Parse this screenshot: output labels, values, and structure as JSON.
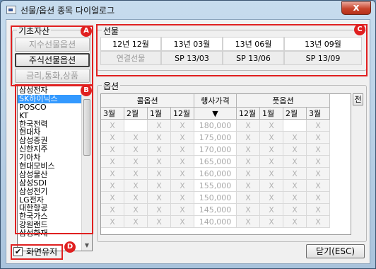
{
  "window": {
    "title": "선물/옵션 종목 다이얼로그",
    "close_glyph": "x"
  },
  "underlying": {
    "title": "기초자산",
    "buttons": [
      {
        "label": "지수선물옵션",
        "state": "disabled"
      },
      {
        "label": "주식선물옵션",
        "state": "active"
      },
      {
        "label": "금리,통화,상품",
        "state": "disabled"
      }
    ]
  },
  "stock_list": {
    "items": [
      "삼성전자",
      "SK하이닉스",
      "POSCO",
      "KT",
      "한국전력",
      "현대차",
      "삼성증권",
      "신한지주",
      "기아차",
      "현대모비스",
      "삼성물산",
      "삼성SDI",
      "삼성전기",
      "LG전자",
      "대한항공",
      "한국가스",
      "강원랜드",
      "삼성화재"
    ],
    "selected_index": 1
  },
  "futures": {
    "title": "선물",
    "months": [
      "12년 12월",
      "13년 03월",
      "13년 06월",
      "13년 09월"
    ],
    "rows2": [
      "연결선물",
      "SP 13/03",
      "SP 13/06",
      "SP 13/09"
    ]
  },
  "options": {
    "title": "옵션",
    "call_label": "콜옵션",
    "strike_label": "행사가격",
    "put_label": "풋옵션",
    "corner_label": "전",
    "sort_glyph": "▼",
    "call_months": [
      "3월",
      "2월",
      "1월",
      "12월"
    ],
    "put_months": [
      "12월",
      "1월",
      "2월",
      "3월"
    ],
    "strikes": [
      "180,000",
      "175,000",
      "170,000",
      "165,000",
      "160,000",
      "155,000",
      "150,000",
      "145,000",
      "140,000"
    ],
    "mark": "X"
  },
  "footer": {
    "keep_screen_label": "화면유지",
    "keep_screen_checked": true,
    "check_glyph": "✔",
    "close_label": "닫기(ESC)"
  },
  "annotations": [
    "A",
    "B",
    "C",
    "D"
  ]
}
